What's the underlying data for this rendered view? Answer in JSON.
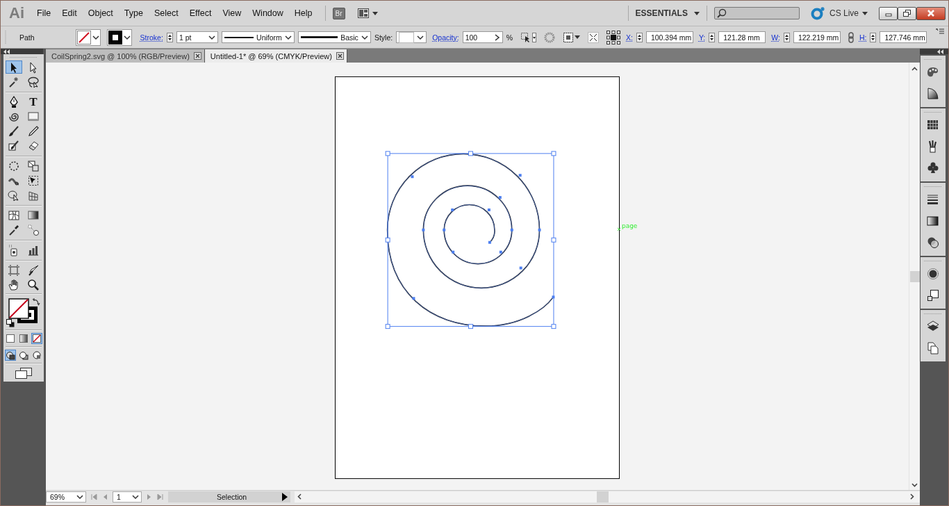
{
  "app": {
    "logo": "Ai",
    "bridge": "Br",
    "workspace": "ESSENTIALS",
    "cs_live": "CS Live"
  },
  "menu": [
    "File",
    "Edit",
    "Object",
    "Type",
    "Select",
    "Effect",
    "View",
    "Window",
    "Help"
  ],
  "control_bar": {
    "object_type": "Path",
    "stroke_label": "Stroke:",
    "stroke_weight": "1 pt",
    "profile": "Uniform",
    "brush": "Basic",
    "style_label": "Style:",
    "opacity_label": "Opacity:",
    "opacity": "100",
    "percent": "%",
    "fields": [
      {
        "label": "X:",
        "value": "100.394 mm"
      },
      {
        "label": "Y:",
        "value": "121.28 mm"
      },
      {
        "label": "W:",
        "value": "122.219 mm"
      },
      {
        "label": "H:",
        "value": "127.746 mm"
      }
    ]
  },
  "document_tabs": [
    {
      "title": "CoilSpring2.svg @ 100% (RGB/Preview)",
      "selected": false
    },
    {
      "title": "Untitled-1* @ 69% (CMYK/Preview)",
      "selected": true
    }
  ],
  "tools": [
    {
      "selected": true
    },
    {
      "selected": false
    },
    {
      "selected": false
    },
    {
      "selected": false
    },
    {
      "selected": false
    },
    {
      "selected": false,
      "glyph": "T"
    },
    {
      "selected": false
    },
    {
      "selected": false
    },
    {
      "selected": false
    },
    {
      "selected": false
    },
    {
      "selected": false
    },
    {
      "selected": false
    },
    {
      "selected": false
    },
    {
      "selected": false
    },
    {
      "selected": false
    },
    {
      "selected": false
    },
    {
      "selected": false
    },
    {
      "selected": false
    },
    {
      "selected": false
    },
    {
      "selected": false
    },
    {
      "selected": false
    },
    {
      "selected": false
    },
    {
      "selected": false
    },
    {
      "selected": false
    },
    {
      "selected": false
    },
    {
      "selected": false
    },
    {
      "selected": false
    },
    {
      "selected": false
    }
  ],
  "color_modes": [
    {
      "selected": false
    },
    {
      "selected": false
    },
    {
      "selected": true
    }
  ],
  "draw_modes": [
    {
      "selected": true
    },
    {
      "selected": false
    },
    {
      "selected": false
    }
  ],
  "canvas": {
    "artboard_label": "page"
  },
  "status_bar": {
    "zoom": "69%",
    "artboard": "1",
    "tool": "Selection"
  }
}
